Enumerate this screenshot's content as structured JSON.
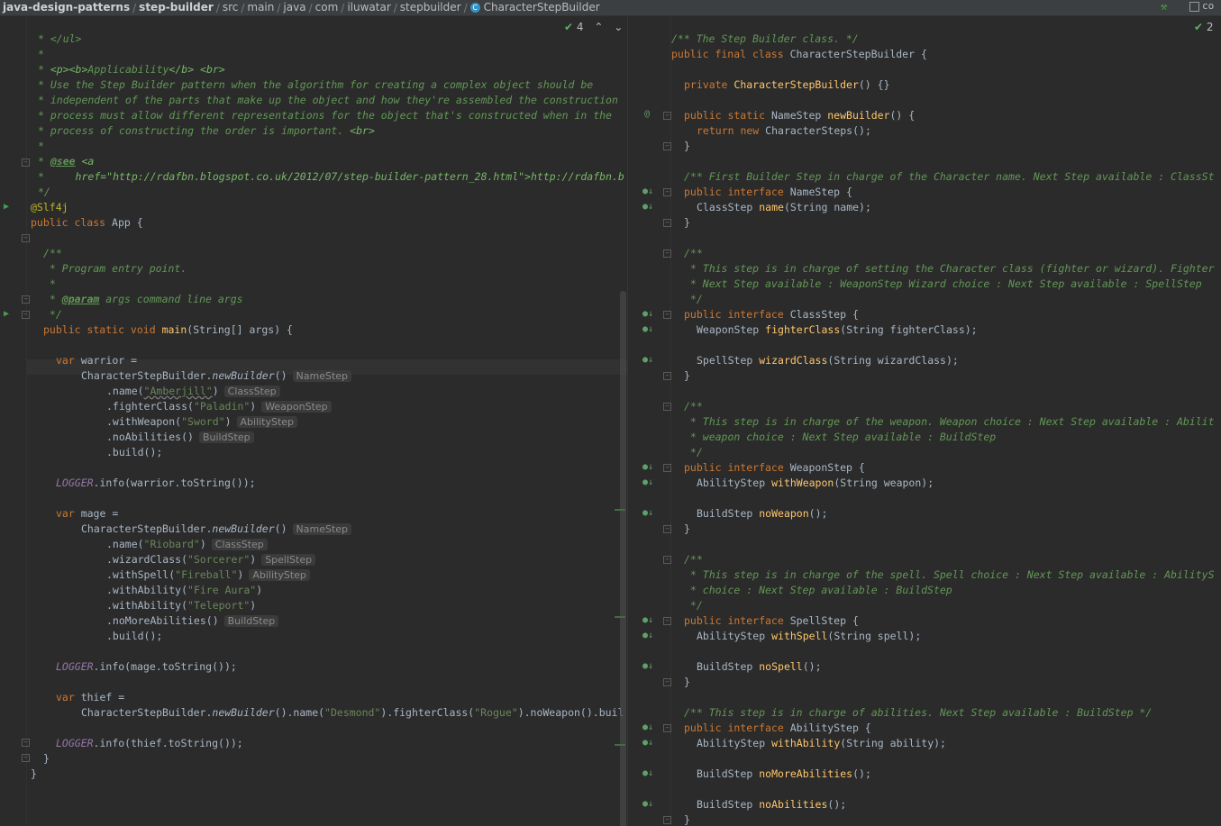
{
  "breadcrumb": {
    "items": [
      "java-design-patterns",
      "step-builder",
      "src",
      "main",
      "java",
      "com",
      "iluwatar",
      "stepbuilder",
      "CharacterStepBuilder"
    ],
    "right_tab": "co"
  },
  "left_editor": {
    "inspection": {
      "count": "4"
    },
    "lines": [
      [
        [
          "cm",
          "* </ul>"
        ]
      ],
      [
        [
          "cm",
          "*"
        ]
      ],
      [
        [
          "cm",
          "* "
        ],
        [
          "cmhtml",
          "<p><b>"
        ],
        [
          "cm",
          "Applicability"
        ],
        [
          "cmhtml",
          "</b> <br>"
        ]
      ],
      [
        [
          "cm",
          "* Use the Step Builder pattern when the algorithm for creating a complex object should be"
        ]
      ],
      [
        [
          "cm",
          "* independent of the parts that make up the object and how they're assembled the construction"
        ]
      ],
      [
        [
          "cm",
          "* process must allow different representations for the object that's constructed when in the"
        ]
      ],
      [
        [
          "cm",
          "* process of constructing the order is important. "
        ],
        [
          "cmhtml",
          "<br>"
        ]
      ],
      [
        [
          "cm",
          "*"
        ]
      ],
      [
        [
          "cm",
          "* "
        ],
        [
          "cmtag",
          "@see"
        ],
        [
          "cm",
          " "
        ],
        [
          "cmhtml",
          "<a"
        ]
      ],
      [
        [
          "cm",
          "*     "
        ],
        [
          "cmhtml",
          "href=\"http://rdafbn.blogspot.co.uk/2012/07/step-builder-pattern_28.html\">http://rdafbn.b"
        ]
      ],
      [
        [
          "cm",
          "*/"
        ]
      ],
      [
        [
          "an",
          "@Slf4j"
        ]
      ],
      [
        [
          "kw",
          "public class "
        ],
        [
          "n",
          "App {"
        ]
      ],
      [
        [
          "n",
          ""
        ]
      ],
      [
        [
          "cm",
          "/**"
        ]
      ],
      [
        [
          "cm",
          " * Program entry point."
        ]
      ],
      [
        [
          "cm",
          " *"
        ]
      ],
      [
        [
          "cm",
          " * "
        ],
        [
          "cmtag",
          "@param"
        ],
        [
          "cm",
          " args command line args"
        ]
      ],
      [
        [
          "cm",
          " */"
        ]
      ],
      [
        [
          "kw",
          "public static void "
        ],
        [
          "fn",
          "main"
        ],
        [
          "n",
          "(String[] args) {"
        ]
      ],
      [
        [
          "n",
          ""
        ]
      ],
      [
        [
          "kw",
          "var "
        ],
        [
          "n",
          "warrior ="
        ]
      ],
      [
        [
          "n",
          "CharacterStepBuilder."
        ],
        [
          "sm",
          "newBuilder"
        ],
        [
          "n",
          "()"
        ],
        [
          "hint",
          "NameStep"
        ]
      ],
      [
        [
          "n",
          ".name("
        ],
        [
          "str",
          "\"Amberjill\""
        ],
        [
          "n",
          ")"
        ],
        [
          "hint",
          "ClassStep"
        ]
      ],
      [
        [
          "n",
          ".fighterClass("
        ],
        [
          "str",
          "\"Paladin\""
        ],
        [
          "n",
          ")"
        ],
        [
          "hint",
          "WeaponStep"
        ]
      ],
      [
        [
          "n",
          ".withWeapon("
        ],
        [
          "str",
          "\"Sword\""
        ],
        [
          "n",
          ")"
        ],
        [
          "hint",
          "AbilityStep"
        ]
      ],
      [
        [
          "n",
          ".noAbilities()"
        ],
        [
          "hint",
          "BuildStep"
        ]
      ],
      [
        [
          "n",
          ".build();"
        ]
      ],
      [
        [
          "n",
          ""
        ]
      ],
      [
        [
          "cst",
          "LOGGER"
        ],
        [
          "n",
          ".info(warrior.toString());"
        ]
      ],
      [
        [
          "n",
          ""
        ]
      ],
      [
        [
          "kw",
          "var "
        ],
        [
          "n",
          "mage ="
        ]
      ],
      [
        [
          "n",
          "CharacterStepBuilder."
        ],
        [
          "sm",
          "newBuilder"
        ],
        [
          "n",
          "()"
        ],
        [
          "hint",
          "NameStep"
        ]
      ],
      [
        [
          "n",
          ".name("
        ],
        [
          "str",
          "\"Riobard\""
        ],
        [
          "n",
          ")"
        ],
        [
          "hint",
          "ClassStep"
        ]
      ],
      [
        [
          "n",
          ".wizardClass("
        ],
        [
          "str",
          "\"Sorcerer\""
        ],
        [
          "n",
          ")"
        ],
        [
          "hint",
          "SpellStep"
        ]
      ],
      [
        [
          "n",
          ".withSpell("
        ],
        [
          "str",
          "\"Fireball\""
        ],
        [
          "n",
          ")"
        ],
        [
          "hint",
          "AbilityStep"
        ]
      ],
      [
        [
          "n",
          ".withAbility("
        ],
        [
          "str",
          "\"Fire Aura\""
        ],
        [
          "n",
          ")"
        ]
      ],
      [
        [
          "n",
          ".withAbility("
        ],
        [
          "str",
          "\"Teleport\""
        ],
        [
          "n",
          ")"
        ]
      ],
      [
        [
          "n",
          ".noMoreAbilities()"
        ],
        [
          "hint",
          "BuildStep"
        ]
      ],
      [
        [
          "n",
          ".build();"
        ]
      ],
      [
        [
          "n",
          ""
        ]
      ],
      [
        [
          "cst",
          "LOGGER"
        ],
        [
          "n",
          ".info(mage.toString());"
        ]
      ],
      [
        [
          "n",
          ""
        ]
      ],
      [
        [
          "kw",
          "var "
        ],
        [
          "n",
          "thief ="
        ]
      ],
      [
        [
          "n",
          "CharacterStepBuilder."
        ],
        [
          "sm",
          "newBuilder"
        ],
        [
          "n",
          "().name("
        ],
        [
          "str",
          "\"Desmond\""
        ],
        [
          "n",
          ").fighterClass("
        ],
        [
          "str",
          "\"Rogue\""
        ],
        [
          "n",
          ").noWeapon().buil"
        ]
      ],
      [
        [
          "n",
          ""
        ]
      ],
      [
        [
          "cst",
          "LOGGER"
        ],
        [
          "n",
          ".info(thief.toString());"
        ]
      ],
      [
        [
          "n",
          "}"
        ]
      ],
      [
        [
          "n",
          "}"
        ]
      ]
    ]
  },
  "right_editor": {
    "inspection": {
      "count": "2"
    },
    "lines": [
      [
        [
          "cm",
          "/** The Step Builder class. */"
        ]
      ],
      [
        [
          "kw",
          "public final class "
        ],
        [
          "n",
          "CharacterStepBuilder {"
        ]
      ],
      [
        [
          "n",
          ""
        ]
      ],
      [
        [
          "kw",
          "private "
        ],
        [
          "fn",
          "CharacterStepBuilder"
        ],
        [
          "n",
          "() {}"
        ]
      ],
      [
        [
          "n",
          ""
        ]
      ],
      [
        [
          "kw",
          "public static "
        ],
        [
          "n",
          "NameStep "
        ],
        [
          "fn",
          "newBuilder"
        ],
        [
          "n",
          "() {"
        ]
      ],
      [
        [
          "kw",
          "return new "
        ],
        [
          "n",
          "CharacterSteps();"
        ]
      ],
      [
        [
          "n",
          "}"
        ]
      ],
      [
        [
          "n",
          ""
        ]
      ],
      [
        [
          "cm",
          "/** First Builder Step in charge of the Character name. Next Step available : ClassSt"
        ]
      ],
      [
        [
          "kw",
          "public interface "
        ],
        [
          "n",
          "NameStep {"
        ]
      ],
      [
        [
          "n",
          "ClassStep "
        ],
        [
          "fn",
          "name"
        ],
        [
          "n",
          "(String name);"
        ]
      ],
      [
        [
          "n",
          "}"
        ]
      ],
      [
        [
          "n",
          ""
        ]
      ],
      [
        [
          "cm",
          "/**"
        ]
      ],
      [
        [
          "cm",
          " * This step is in charge of setting the Character class (fighter or wizard). Fighter"
        ]
      ],
      [
        [
          "cm",
          " * Next Step available : WeaponStep Wizard choice : Next Step available : SpellStep"
        ]
      ],
      [
        [
          "cm",
          " */"
        ]
      ],
      [
        [
          "kw",
          "public interface "
        ],
        [
          "n",
          "ClassStep {"
        ]
      ],
      [
        [
          "n",
          "WeaponStep "
        ],
        [
          "fn",
          "fighterClass"
        ],
        [
          "n",
          "(String fighterClass);"
        ]
      ],
      [
        [
          "n",
          ""
        ]
      ],
      [
        [
          "n",
          "SpellStep "
        ],
        [
          "fn",
          "wizardClass"
        ],
        [
          "n",
          "(String wizardClass);"
        ]
      ],
      [
        [
          "n",
          "}"
        ]
      ],
      [
        [
          "n",
          ""
        ]
      ],
      [
        [
          "cm",
          "/**"
        ]
      ],
      [
        [
          "cm",
          " * This step is in charge of the weapon. Weapon choice : Next Step available : Abilit"
        ]
      ],
      [
        [
          "cm",
          " * weapon choice : Next Step available : BuildStep"
        ]
      ],
      [
        [
          "cm",
          " */"
        ]
      ],
      [
        [
          "kw",
          "public interface "
        ],
        [
          "n",
          "WeaponStep {"
        ]
      ],
      [
        [
          "n",
          "AbilityStep "
        ],
        [
          "fn",
          "withWeapon"
        ],
        [
          "n",
          "(String weapon);"
        ]
      ],
      [
        [
          "n",
          ""
        ]
      ],
      [
        [
          "n",
          "BuildStep "
        ],
        [
          "fn",
          "noWeapon"
        ],
        [
          "n",
          "();"
        ]
      ],
      [
        [
          "n",
          "}"
        ]
      ],
      [
        [
          "n",
          ""
        ]
      ],
      [
        [
          "cm",
          "/**"
        ]
      ],
      [
        [
          "cm",
          " * This step is in charge of the spell. Spell choice : Next Step available : AbilityS"
        ]
      ],
      [
        [
          "cm",
          " * choice : Next Step available : BuildStep"
        ]
      ],
      [
        [
          "cm",
          " */"
        ]
      ],
      [
        [
          "kw",
          "public interface "
        ],
        [
          "n",
          "SpellStep {"
        ]
      ],
      [
        [
          "n",
          "AbilityStep "
        ],
        [
          "fn",
          "withSpell"
        ],
        [
          "n",
          "(String spell);"
        ]
      ],
      [
        [
          "n",
          ""
        ]
      ],
      [
        [
          "n",
          "BuildStep "
        ],
        [
          "fn",
          "noSpell"
        ],
        [
          "n",
          "();"
        ]
      ],
      [
        [
          "n",
          "}"
        ]
      ],
      [
        [
          "n",
          ""
        ]
      ],
      [
        [
          "cm",
          "/** This step is in charge of abilities. Next Step available : BuildStep */"
        ]
      ],
      [
        [
          "kw",
          "public interface "
        ],
        [
          "n",
          "AbilityStep {"
        ]
      ],
      [
        [
          "n",
          "AbilityStep "
        ],
        [
          "fn",
          "withAbility"
        ],
        [
          "n",
          "(String ability);"
        ]
      ],
      [
        [
          "n",
          ""
        ]
      ],
      [
        [
          "n",
          "BuildStep "
        ],
        [
          "fn",
          "noMoreAbilities"
        ],
        [
          "n",
          "();"
        ]
      ],
      [
        [
          "n",
          ""
        ]
      ],
      [
        [
          "n",
          "BuildStep "
        ],
        [
          "fn",
          "noAbilities"
        ],
        [
          "n",
          "();"
        ]
      ],
      [
        [
          "n",
          "}"
        ]
      ]
    ]
  }
}
